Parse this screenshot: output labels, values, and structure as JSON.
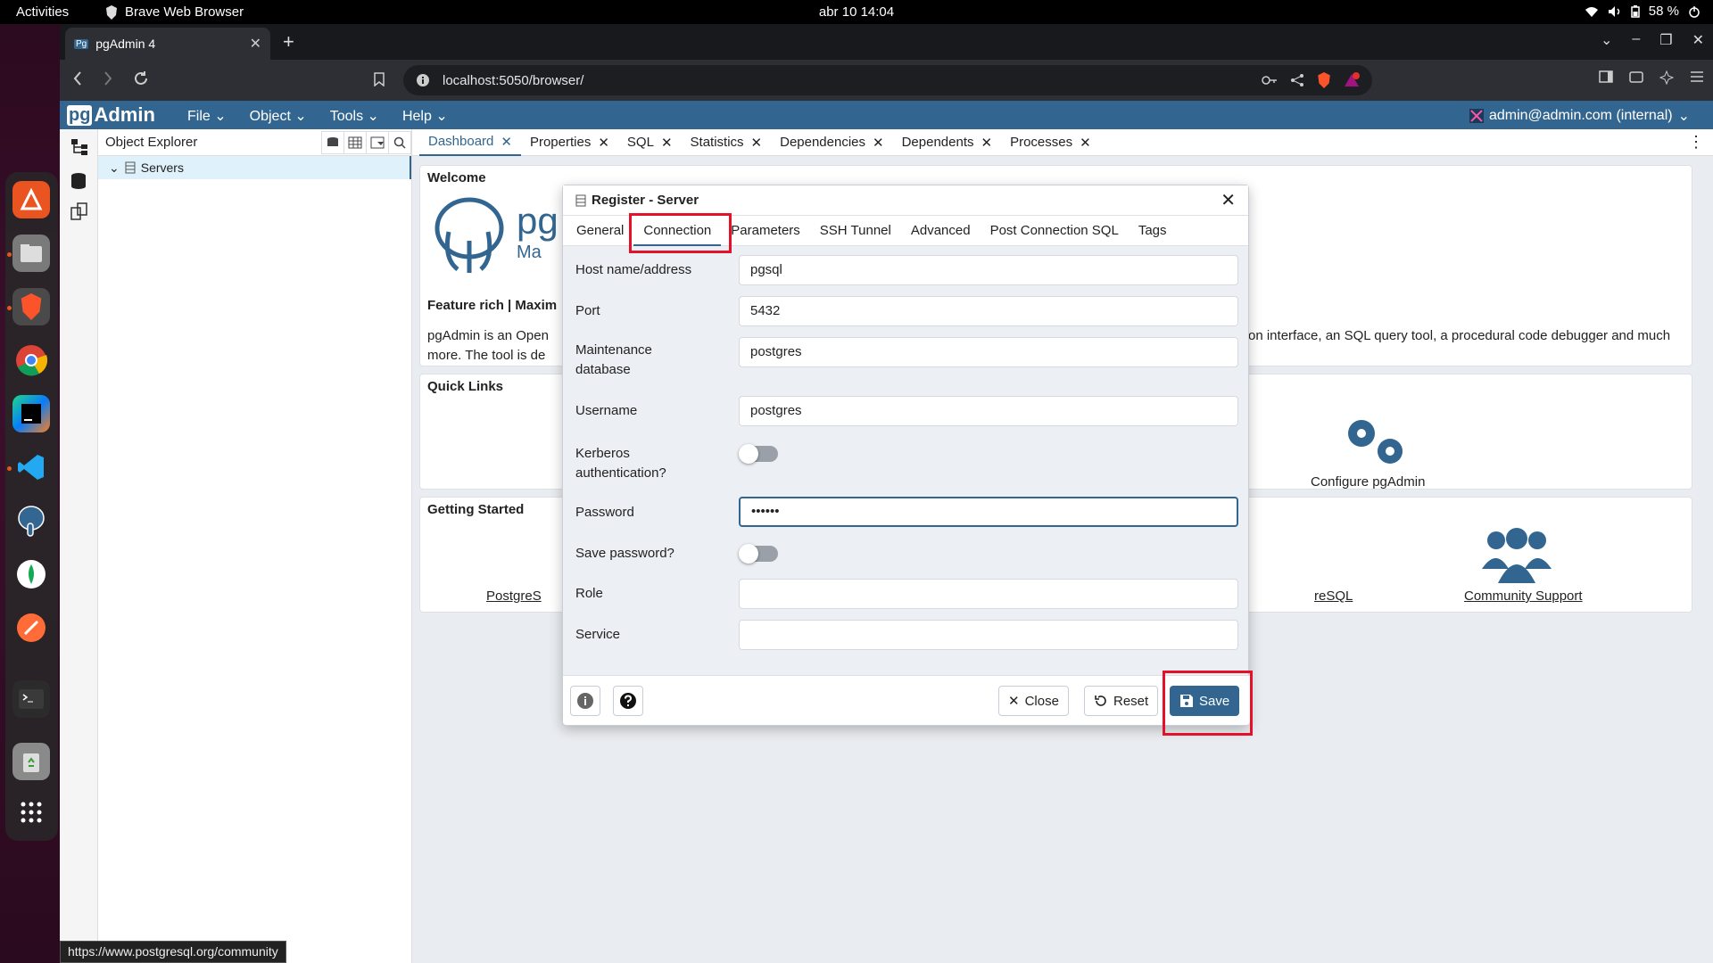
{
  "system": {
    "activities": "Activities",
    "app_name": "Brave Web Browser",
    "clock": "abr 10  14:04",
    "battery": "58 %"
  },
  "browser": {
    "tab_title": "pgAdmin 4",
    "url": "localhost:5050/browser/"
  },
  "pgadmin": {
    "logo": "Admin",
    "logo_pg": "pg",
    "menu": [
      "File",
      "Object",
      "Tools",
      "Help"
    ],
    "user": "admin@admin.com (internal)",
    "explorer_title": "Object Explorer",
    "tree": {
      "servers": "Servers"
    },
    "tabs": [
      "Dashboard",
      "Properties",
      "SQL",
      "Statistics",
      "Dependencies",
      "Dependents",
      "Processes"
    ]
  },
  "dashboard": {
    "welcome": "Welcome",
    "brand_partial": "pg",
    "brand_sub_partial": "Ma",
    "feature": "Feature rich | Maxim",
    "desc_left": "pgAdmin is an Open",
    "desc_left2": "more. The tool is de",
    "desc_right": "on interface, an SQL query tool, a procedural code debugger and much",
    "quick_links": "Quick Links",
    "configure": "Configure pgAdmin",
    "getting_started": "Getting Started",
    "postgres_link": "PostgreS",
    "postgres_link_right": "reSQL",
    "community": "Community Support"
  },
  "dialog": {
    "title": "Register - Server",
    "tabs": [
      "General",
      "Connection",
      "Parameters",
      "SSH Tunnel",
      "Advanced",
      "Post Connection SQL",
      "Tags"
    ],
    "active_tab": "Connection",
    "fields": {
      "host": {
        "label": "Host name/address",
        "value": "pgsql"
      },
      "port": {
        "label": "Port",
        "value": "5432"
      },
      "maint_db": {
        "label": "Maintenance database",
        "value": "postgres"
      },
      "username": {
        "label": "Username",
        "value": "postgres"
      },
      "kerberos": {
        "label": "Kerberos authentication?",
        "value": false
      },
      "password": {
        "label": "Password",
        "value": "••••••"
      },
      "save_password": {
        "label": "Save password?",
        "value": false
      },
      "role": {
        "label": "Role",
        "value": ""
      },
      "service": {
        "label": "Service",
        "value": ""
      }
    },
    "buttons": {
      "close": "Close",
      "reset": "Reset",
      "save": "Save"
    }
  },
  "statusbar": "https://www.postgresql.org/community",
  "colors": {
    "pg_blue": "#326690",
    "highlight": "#e4112a"
  }
}
